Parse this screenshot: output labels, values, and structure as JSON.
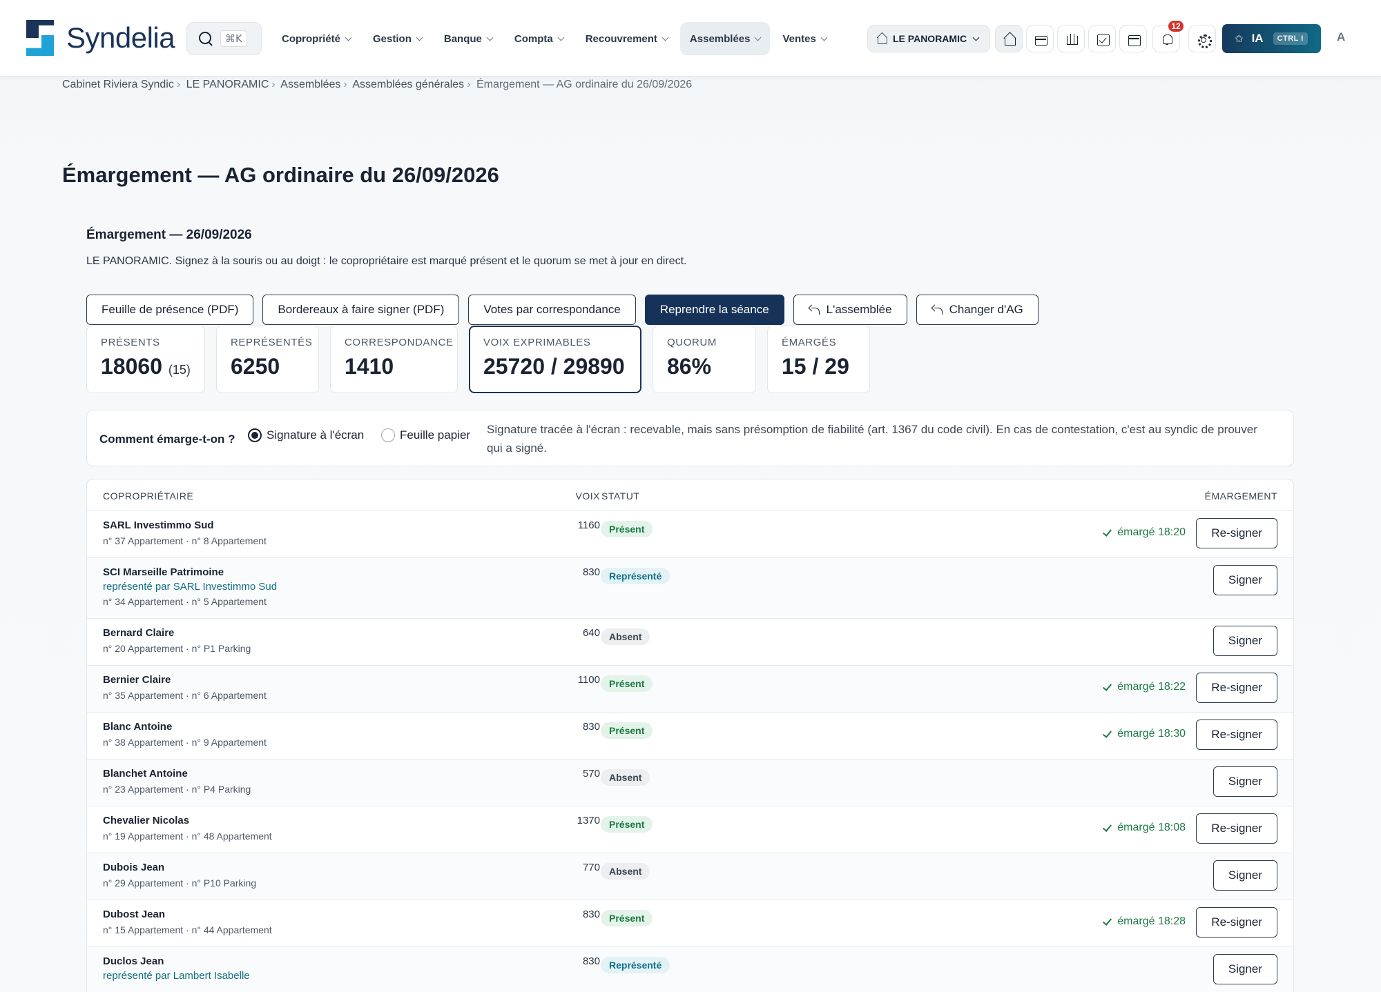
{
  "app": {
    "logo_text": "Syndelia",
    "search_shortcut": "⌘K",
    "menu": [
      {
        "label": "Copropriété"
      },
      {
        "label": "Gestion"
      },
      {
        "label": "Banque"
      },
      {
        "label": "Compta"
      },
      {
        "label": "Recouvrement"
      },
      {
        "label": "Assemblées"
      },
      {
        "label": "Ventes"
      }
    ],
    "active_menu": "Assemblées",
    "building_select": "LE PANORAMIC",
    "toolbar_icons": [
      "home-icon",
      "folder-icon",
      "bank-icon",
      "tasks-icon",
      "calendar-icon",
      "bell-icon",
      "gear-icon"
    ],
    "notification_count": "12",
    "ia_label": "IA",
    "ia_shortcut": "CTRL I",
    "avatar_initial": "A"
  },
  "breadcrumb": [
    "Cabinet Riviera Syndic",
    "LE PANORAMIC",
    "Assemblées",
    "Assemblées générales",
    "Émargement — AG ordinaire du 26/09/2026"
  ],
  "page_title": "Émargement — AG ordinaire du 26/09/2026",
  "session": {
    "title": "Émargement — 26/09/2026",
    "description": "LE PANORAMIC. Signez à la souris ou au doigt : le copropriétaire est marqué présent et le quorum se met à jour en direct."
  },
  "actions": {
    "feuille_presence": "Feuille de présence (PDF)",
    "bordereaux": "Bordereaux à faire signer (PDF)",
    "votes_correspondance": "Votes par correspondance",
    "reprendre": "Reprendre la séance",
    "assemblee": "L'assemblée",
    "changer_ag": "Changer d'AG"
  },
  "stats": {
    "presents": {
      "label": "PRÉSENTS",
      "value": "18060",
      "sub": "(15)"
    },
    "representes": {
      "label": "REPRÉSENTÉS",
      "value": "6250"
    },
    "correspondance": {
      "label": "CORRESPONDANCE",
      "value": "1410"
    },
    "voix_exprimables": {
      "label": "VOIX EXPRIMABLES",
      "value": "25720 / 29890"
    },
    "quorum": {
      "label": "QUORUM",
      "value": "86%"
    },
    "emarges": {
      "label": "ÉMARGÉS",
      "value": "15 / 29"
    }
  },
  "signing_mode": {
    "question": "Comment émarge-t-on ?",
    "option_screen": "Signature à l'écran",
    "option_paper": "Feuille papier",
    "selected": "Signature à l'écran",
    "note": "Signature tracée à l'écran : recevable, mais sans présomption de fiabilité (art. 1367 du code civil). En cas de contestation, c'est au syndic de prouver qui a signé."
  },
  "table": {
    "headers": {
      "owner": "COPROPRIÉTAIRE",
      "voix": "VOIX",
      "statut": "STATUT",
      "emargement": "ÉMARGEMENT"
    },
    "rows": [
      {
        "name": "SARL Investimmo Sud",
        "proxy": "",
        "lots": "n° 37 Appartement · n° 8 Appartement",
        "voix": "1160",
        "status": "Présent",
        "status_kind": "present",
        "signed": "émargé 18:20",
        "action": "Re-signer"
      },
      {
        "name": "SCI Marseille Patrimoine",
        "proxy": "représenté par SARL Investimmo Sud",
        "lots": "n° 34 Appartement · n° 5 Appartement",
        "voix": "830",
        "status": "Représenté",
        "status_kind": "represente",
        "signed": "",
        "action": "Signer"
      },
      {
        "name": "Bernard Claire",
        "proxy": "",
        "lots": "n° 20 Appartement · n° P1 Parking",
        "voix": "640",
        "status": "Absent",
        "status_kind": "absent",
        "signed": "",
        "action": "Signer"
      },
      {
        "name": "Bernier Claire",
        "proxy": "",
        "lots": "n° 35 Appartement · n° 6 Appartement",
        "voix": "1100",
        "status": "Présent",
        "status_kind": "present",
        "signed": "émargé 18:22",
        "action": "Re-signer"
      },
      {
        "name": "Blanc Antoine",
        "proxy": "",
        "lots": "n° 38 Appartement · n° 9 Appartement",
        "voix": "830",
        "status": "Présent",
        "status_kind": "present",
        "signed": "émargé 18:30",
        "action": "Re-signer"
      },
      {
        "name": "Blanchet Antoine",
        "proxy": "",
        "lots": "n° 23 Appartement · n° P4 Parking",
        "voix": "570",
        "status": "Absent",
        "status_kind": "absent",
        "signed": "",
        "action": "Signer"
      },
      {
        "name": "Chevalier Nicolas",
        "proxy": "",
        "lots": "n° 19 Appartement · n° 48 Appartement",
        "voix": "1370",
        "status": "Présent",
        "status_kind": "present",
        "signed": "émargé 18:08",
        "action": "Re-signer"
      },
      {
        "name": "Dubois Jean",
        "proxy": "",
        "lots": "n° 29 Appartement · n° P10 Parking",
        "voix": "770",
        "status": "Absent",
        "status_kind": "absent",
        "signed": "",
        "action": "Signer"
      },
      {
        "name": "Dubost Jean",
        "proxy": "",
        "lots": "n° 15 Appartement · n° 44 Appartement",
        "voix": "830",
        "status": "Présent",
        "status_kind": "present",
        "signed": "émargé 18:28",
        "action": "Re-signer"
      },
      {
        "name": "Duclos Jean",
        "proxy": "représenté par Lambert Isabelle",
        "lots": "",
        "voix": "830",
        "status": "Représenté",
        "status_kind": "represente",
        "signed": "",
        "action": "Signer"
      }
    ]
  }
}
